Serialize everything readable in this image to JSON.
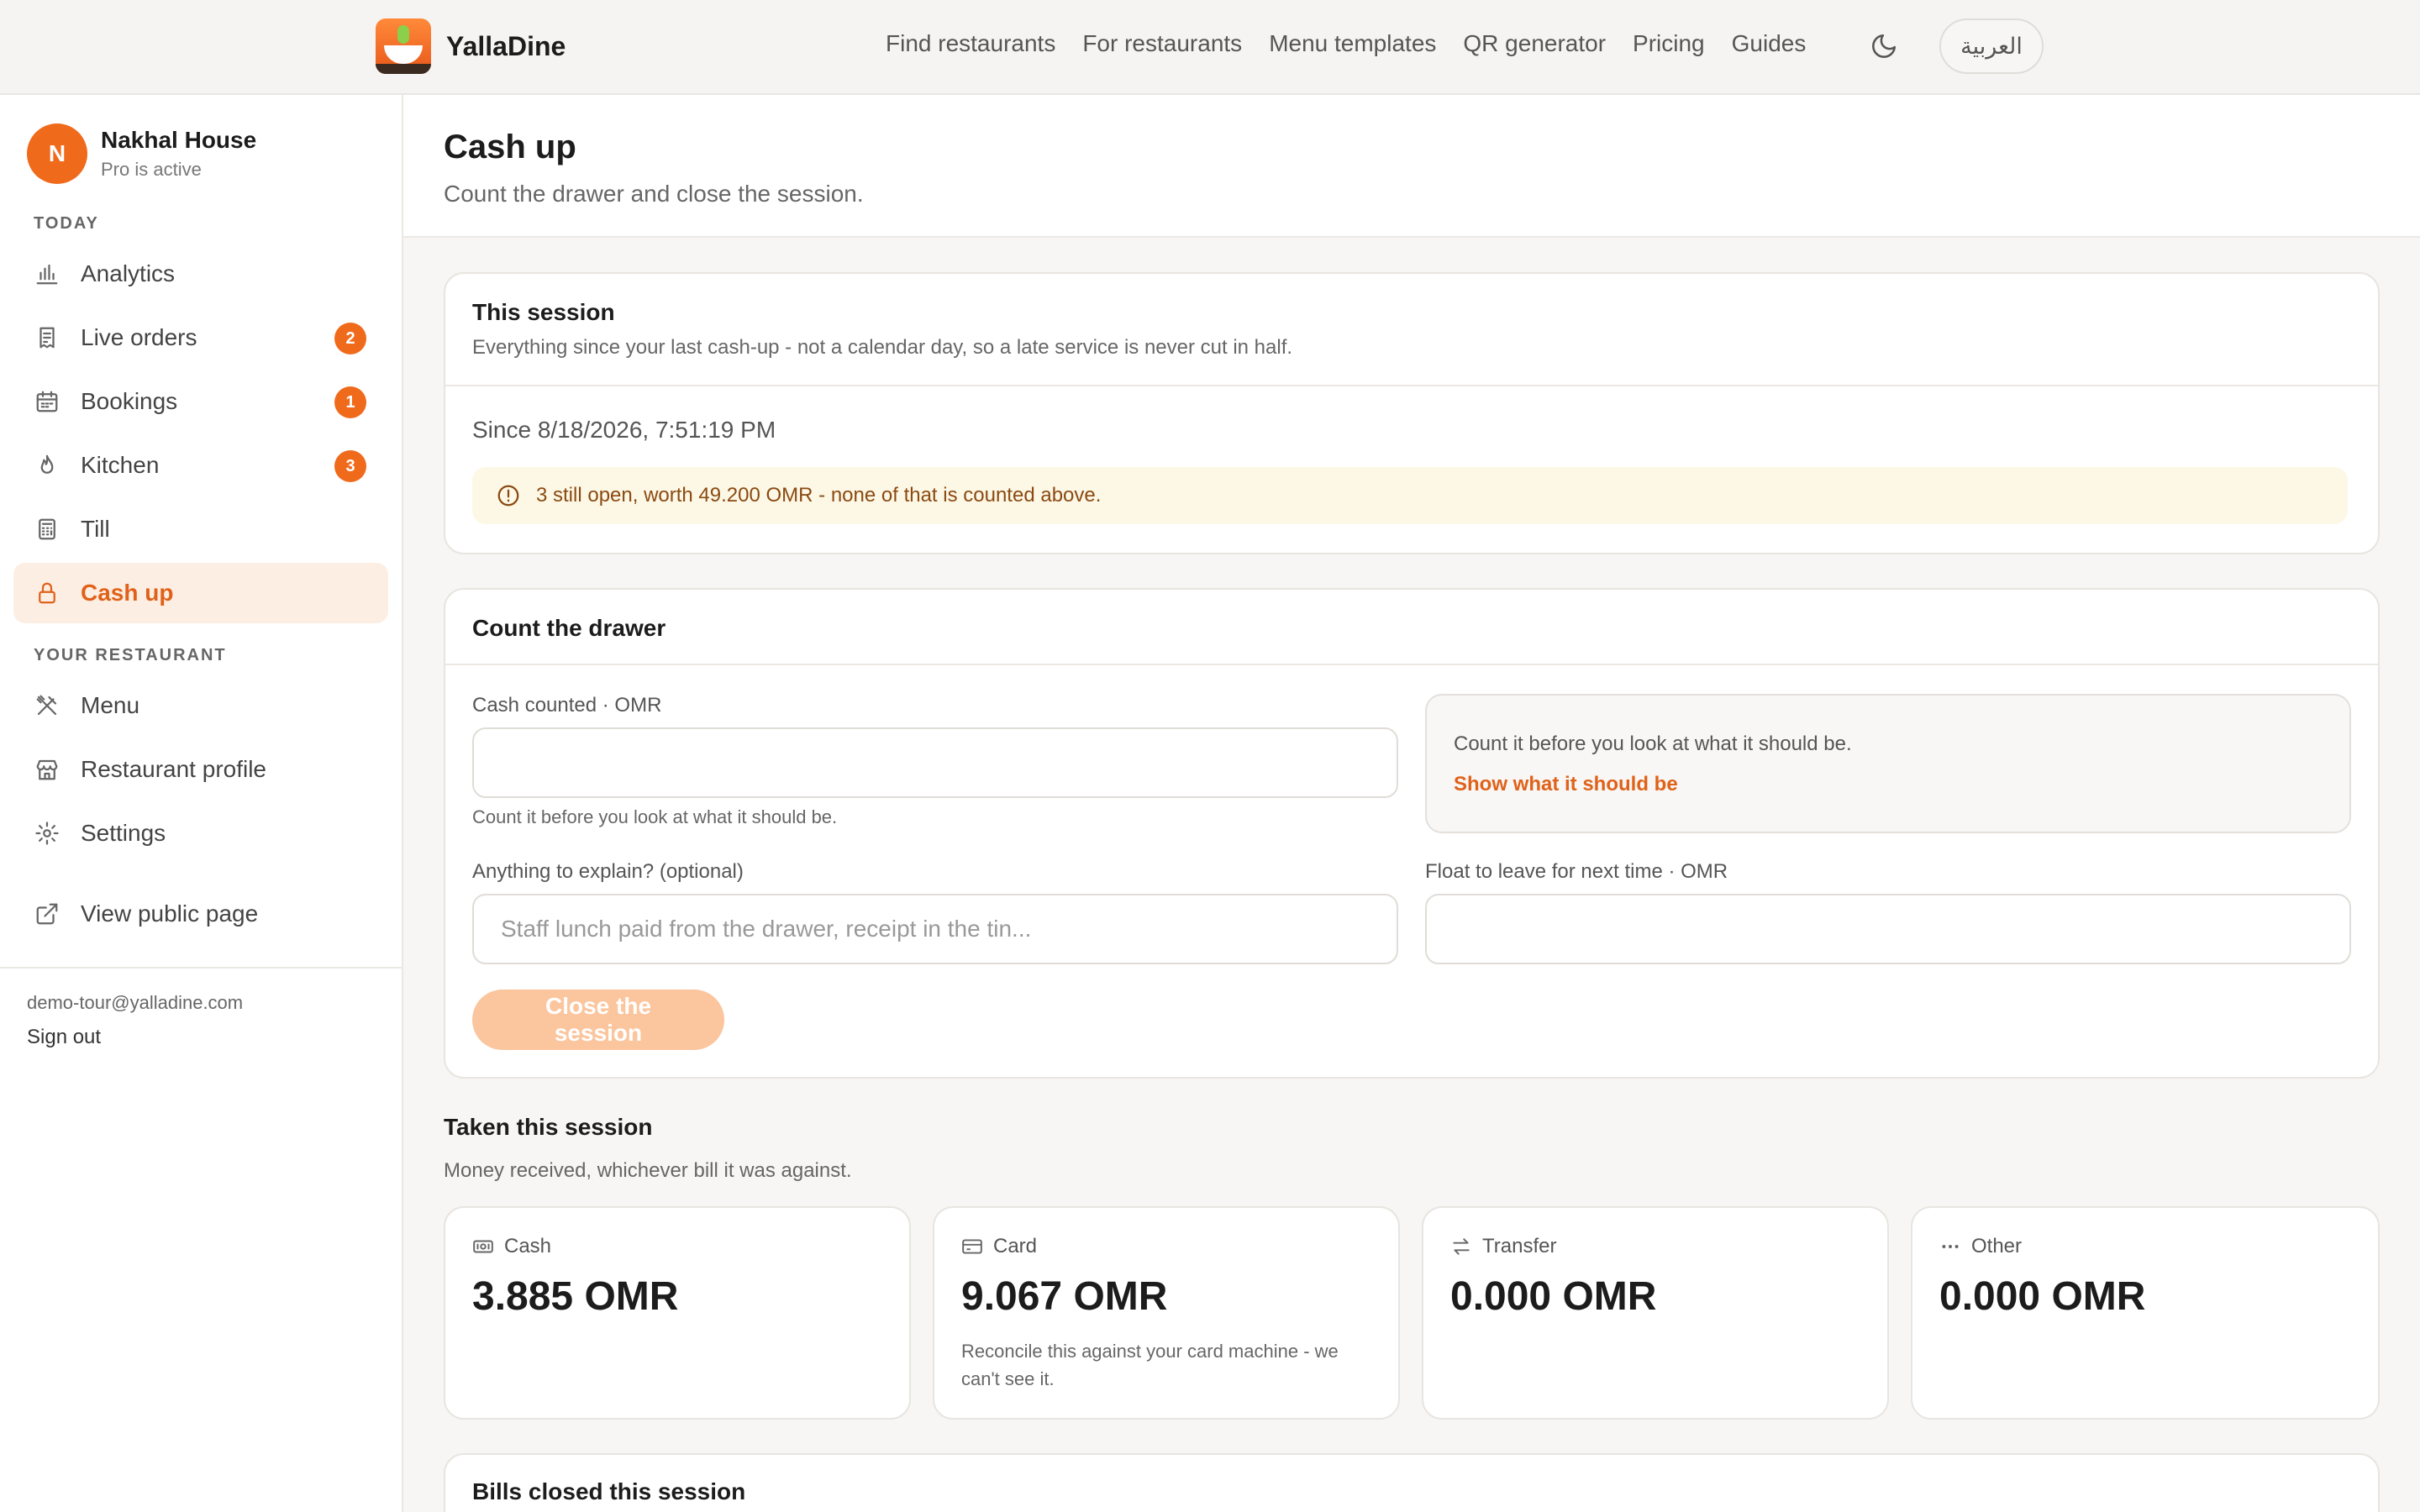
{
  "brand": {
    "name": "YallaDine"
  },
  "nav": {
    "items": [
      "Find restaurants",
      "For restaurants",
      "Menu templates",
      "QR generator",
      "Pricing",
      "Guides"
    ],
    "language_label": "العربية"
  },
  "account": {
    "initial": "N",
    "name": "Nakhal House",
    "plan": "Pro is active"
  },
  "sidebar": {
    "section_today": "TODAY",
    "section_restaurant": "YOUR RESTAURANT",
    "items": [
      {
        "label": "Analytics",
        "icon": "bar-chart-icon"
      },
      {
        "label": "Live orders",
        "icon": "receipt-icon",
        "badge": "2"
      },
      {
        "label": "Bookings",
        "icon": "calendar-icon",
        "badge": "1"
      },
      {
        "label": "Kitchen",
        "icon": "flame-icon",
        "badge": "3"
      },
      {
        "label": "Till",
        "icon": "calculator-icon"
      },
      {
        "label": "Cash up",
        "icon": "lock-icon"
      },
      {
        "label": "Menu",
        "icon": "utensils-icon"
      },
      {
        "label": "Restaurant profile",
        "icon": "store-icon"
      },
      {
        "label": "Settings",
        "icon": "gear-icon"
      },
      {
        "label": "View public page",
        "icon": "external-link-icon"
      }
    ],
    "email": "demo-tour@yalladine.com",
    "sign_out": "Sign out"
  },
  "page": {
    "title": "Cash up",
    "subtitle": "Count the drawer and close the session."
  },
  "session": {
    "title": "This session",
    "subtitle": "Everything since your last cash-up - not a calendar day, so a late service is never cut in half.",
    "since": "Since 8/18/2026, 7:51:19 PM",
    "warning": "3 still open, worth 49.200 OMR - none of that is counted above."
  },
  "drawer": {
    "title": "Count the drawer",
    "cash_label": "Cash counted · OMR",
    "cash_value": "",
    "cash_hint": "Count it before you look at what it should be.",
    "reveal_text": "Count it before you look at what it should be.",
    "reveal_link": "Show what it should be",
    "explain_label": "Anything to explain? (optional)",
    "explain_placeholder": "Staff lunch paid from the drawer, receipt in the tin...",
    "float_label": "Float to leave for next time · OMR",
    "float_value": "",
    "close_button": "Close the session"
  },
  "taken": {
    "title": "Taken this session",
    "subtitle": "Money received, whichever bill it was against.",
    "tiles": [
      {
        "label": "Cash",
        "value": "3.885 OMR",
        "icon": "banknote-icon",
        "note": ""
      },
      {
        "label": "Card",
        "value": "9.067 OMR",
        "icon": "credit-card-icon",
        "note": "Reconcile this against your card machine - we can't see it."
      },
      {
        "label": "Transfer",
        "value": "0.000 OMR",
        "icon": "transfer-arrows-icon",
        "note": ""
      },
      {
        "label": "Other",
        "value": "0.000 OMR",
        "icon": "more-dots-icon",
        "note": ""
      }
    ]
  },
  "bills": {
    "title": "Bills closed this session"
  },
  "colors": {
    "accent": "#f06a1c",
    "accent_soft": "#fdeee3",
    "warning_bg": "#fdf8e6",
    "warning_text": "#8a4a12"
  }
}
